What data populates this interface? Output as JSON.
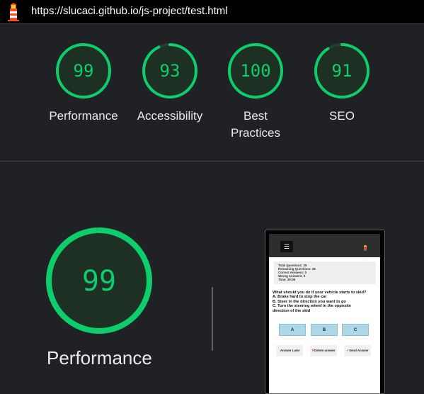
{
  "address_bar": {
    "url": "https://slucaci.github.io/js-project/test.html"
  },
  "colors": {
    "pass": "#0cce6b",
    "gauge_fill": "#1e2f24",
    "background": "#202124"
  },
  "categories": [
    {
      "id": "performance",
      "label": "Performance",
      "score": "99",
      "score_value": 99
    },
    {
      "id": "accessibility",
      "label": "Accessibility",
      "score": "93",
      "score_value": 93
    },
    {
      "id": "best-practices",
      "label": "Best Practices",
      "score": "100",
      "score_value": 100
    },
    {
      "id": "seo",
      "label": "SEO",
      "score": "91",
      "score_value": 91
    }
  ],
  "detail": {
    "score": "99",
    "score_value": 99,
    "label": "Performance"
  },
  "screenshot": {
    "menu_icon": "hamburger-icon",
    "stats": [
      "Total Questions: 28",
      "Remaining Questions: 28",
      "Correct Answers: 0",
      "Wrong Answers: 0",
      "Time: 29:08"
    ],
    "question_lines": [
      "What should you do if your vehicle starts to skid?",
      "A. Brake hard to stop the car",
      "B. Steer in the direction you want to go",
      "C. Turn the steering wheel in the opposite",
      "direction of the skid"
    ],
    "options": [
      "A",
      "B",
      "C"
    ],
    "actions": [
      {
        "icon": "!",
        "label": "Answer Later"
      },
      {
        "icon": "✕",
        "label": "Delete answer"
      },
      {
        "icon": "✓",
        "label": "Send Answer"
      }
    ]
  }
}
